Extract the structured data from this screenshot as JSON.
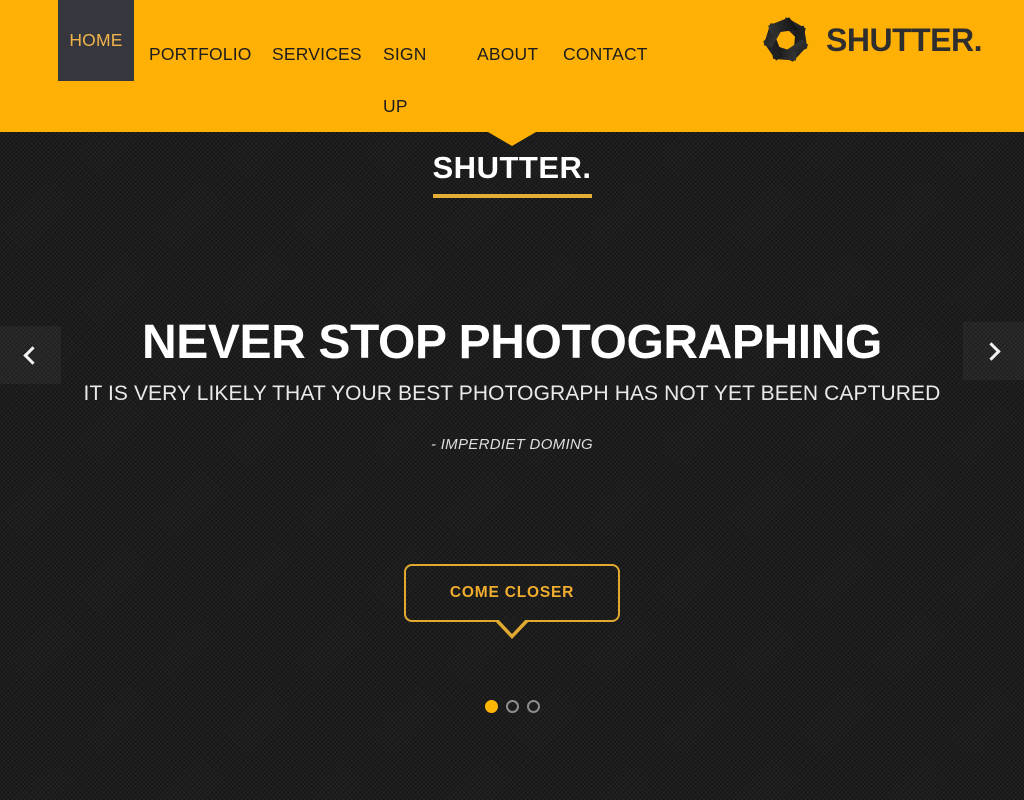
{
  "header": {
    "nav": [
      {
        "label": "HOME",
        "name": "nav-item-home",
        "active": true
      },
      {
        "label": "PORTFOLIO",
        "name": "nav-item-portfolio",
        "active": false
      },
      {
        "label": "SERVICES",
        "name": "nav-item-services",
        "active": false
      },
      {
        "label": "SIGN\nUP",
        "name": "nav-item-sign-up",
        "active": false
      },
      {
        "label": "ABOUT",
        "name": "nav-item-about",
        "active": false
      },
      {
        "label": "CONTACT",
        "name": "nav-item-contact",
        "active": false
      }
    ],
    "brand": {
      "name": "SHUTTER.",
      "logo_icon": "camera-aperture-icon"
    },
    "background_color": "#ffb005",
    "active_item_background": "#36363f",
    "active_item_color": "#f0b44a"
  },
  "hero": {
    "brand_text": "SHUTTER.",
    "brand_underline_color": "#e3ad38",
    "title": "NEVER STOP PHOTOGRAPHING",
    "subtitle": "IT IS VERY LIKELY THAT YOUR BEST PHOTOGRAPH HAS NOT YET BEEN CAPTURED",
    "attribution": "- IMPERDIET DOMING",
    "cta_label": "COME CLOSER",
    "cta_border_color": "#e0a92f",
    "cta_text_color": "#f0ad2e",
    "background_color": "#1d1d1d",
    "carousel": {
      "prev_icon": "chevron-left-icon",
      "next_icon": "chevron-right-icon",
      "slide_count": 3,
      "active_slide": 1,
      "active_dot_color": "#fdb605",
      "inactive_dot_color": "#8c8c8c"
    }
  }
}
